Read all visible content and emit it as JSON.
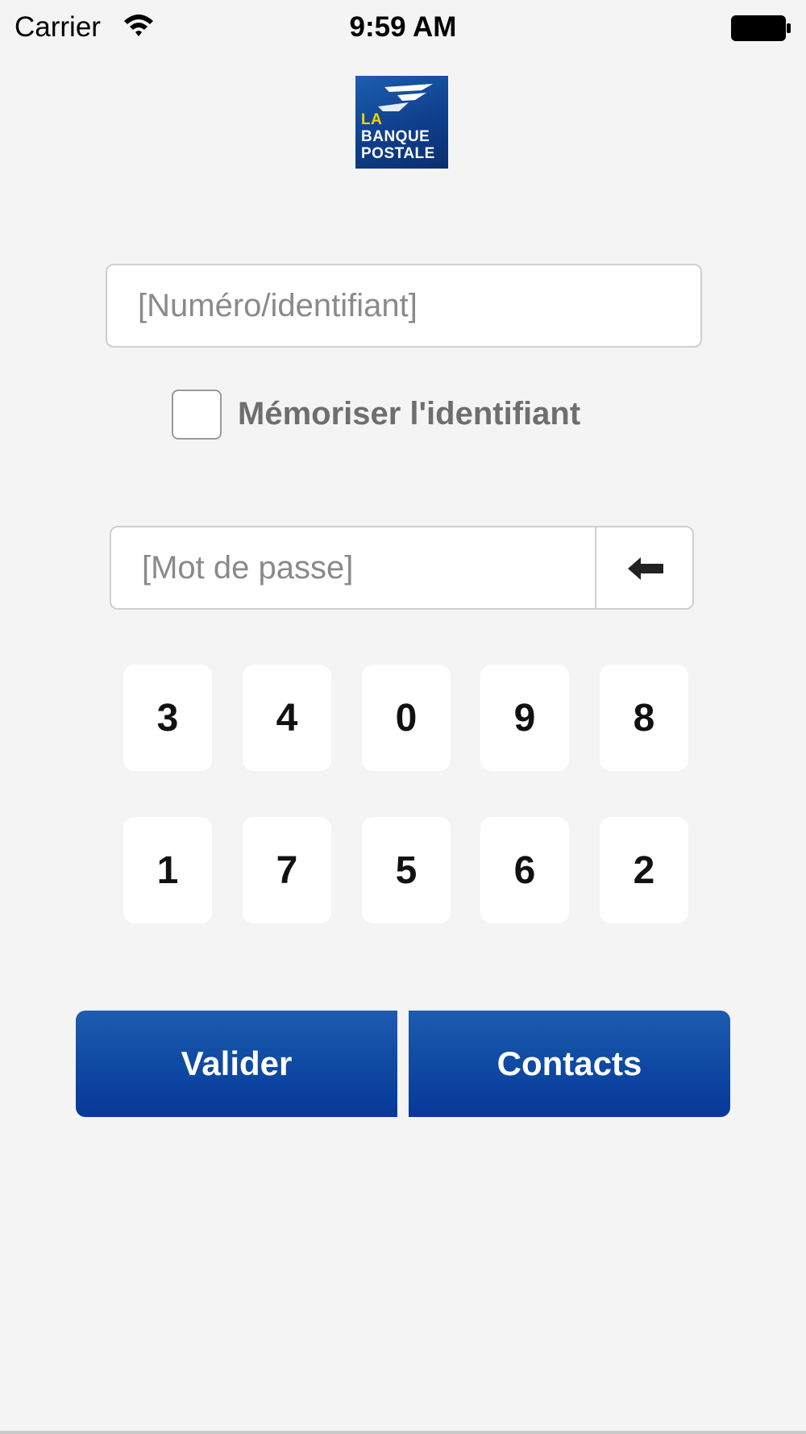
{
  "status_bar": {
    "carrier": "Carrier",
    "time": "9:59 AM"
  },
  "logo": {
    "line1": "LA",
    "line2": "BANQUE",
    "line3": "POSTALE"
  },
  "login": {
    "id_placeholder": "[Numéro/identifiant]",
    "remember_label": "Mémoriser l'identifiant",
    "password_placeholder": "[Mot de passe]"
  },
  "keypad": {
    "row1": [
      "3",
      "4",
      "0",
      "9",
      "8"
    ],
    "row2": [
      "1",
      "7",
      "5",
      "6",
      "2"
    ]
  },
  "actions": {
    "validate_label": "Valider",
    "contacts_label": "Contacts"
  },
  "colors": {
    "background": "#f4f4f4",
    "button_blue": "#0f4aa3",
    "logo_yellow": "#f5d400"
  },
  "icons": {
    "wifi": "wifi-icon",
    "battery": "battery-icon",
    "backspace": "backspace-arrow-icon"
  }
}
